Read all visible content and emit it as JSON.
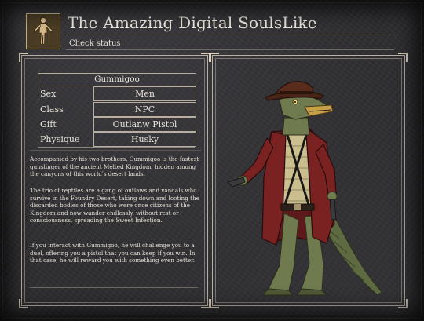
{
  "window": {
    "title": "The Amazing Digital SoulsLike",
    "subtitle": "Check status"
  },
  "character": {
    "name": "Gummigoo",
    "stats": [
      {
        "label": "Sex",
        "value": "Men"
      },
      {
        "label": "Class",
        "value": "NPC"
      },
      {
        "label": "Gift",
        "value": "Outlanw Pistol"
      },
      {
        "label": "Physique",
        "value": "Husky"
      }
    ],
    "description": [
      "Accompanied by his two brothers, Gummigoo is the fastest gunslinger of the ancient Melted Kingdom, hidden among the canyons of this world's desert lands.",
      "The trio of reptiles are a gang of outlaws and vandals who survive in the Foundry Desert, taking down and looting the discarded bodies of those who were once citizens of the Kingdom and now wander endlessly, without rest or consciousness, spreading the Sweet Infection.",
      "If you interact with Gummigoo, he will challenge you to a duel, offering you a pistol that you can keep if you win. In that case, he will reward you with something even better."
    ]
  },
  "icons": {
    "portrait": "character-figure-icon"
  },
  "colors": {
    "background": "#2e2d30",
    "frame": "#b8afa2",
    "text": "#e6e1d6",
    "coat": "#6b1e1e",
    "skin": "#6f7a4e",
    "hat": "#5a2c1c"
  }
}
